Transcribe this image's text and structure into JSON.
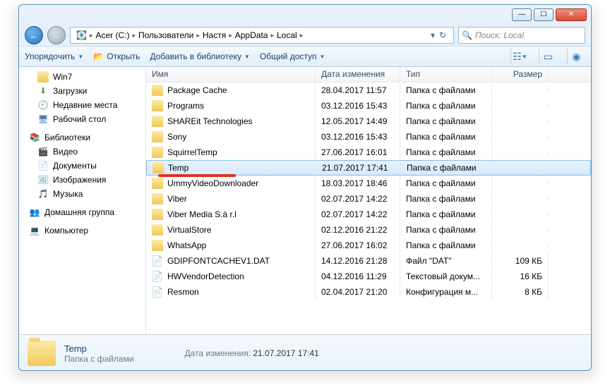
{
  "breadcrumb": [
    "Acer (C:)",
    "Пользователи",
    "Настя",
    "AppData",
    "Local"
  ],
  "search_placeholder": "Поиск: Local",
  "toolbar": {
    "organize": "Упорядочить",
    "open": "Открыть",
    "addlib": "Добавить в библиотеку",
    "share": "Общий доступ"
  },
  "columns": {
    "name": "Имя",
    "date": "Дата изменения",
    "type": "Тип",
    "size": "Размер"
  },
  "sidebar": [
    {
      "icon": "folder",
      "label": "Win7",
      "indent": 1
    },
    {
      "icon": "⬇",
      "label": "Загрузки",
      "indent": 1,
      "color": "#5a9f4a"
    },
    {
      "icon": "🕘",
      "label": "Недавние места",
      "indent": 1,
      "color": "#7a6ab0"
    },
    {
      "icon": "🖥",
      "label": "Рабочий стол",
      "indent": 1,
      "color": "#4a7ab0"
    },
    {
      "icon": "📚",
      "label": "Библиотеки",
      "indent": 0,
      "color": "#4a90c0"
    },
    {
      "icon": "🎬",
      "label": "Видео",
      "indent": 1,
      "color": "#3a6ab0"
    },
    {
      "icon": "📄",
      "label": "Документы",
      "indent": 1,
      "color": "#7a6a4a"
    },
    {
      "icon": "🖼",
      "label": "Изображения",
      "indent": 1,
      "color": "#4a9aa0"
    },
    {
      "icon": "🎵",
      "label": "Музыка",
      "indent": 1,
      "color": "#4a8ac0"
    },
    {
      "icon": "👥",
      "label": "Домашняя группа",
      "indent": 0,
      "color": "#6a9a5a"
    },
    {
      "icon": "💻",
      "label": "Компьютер",
      "indent": 0,
      "color": "#5a7a9a"
    }
  ],
  "files": [
    {
      "icon": "folder",
      "name": "Package Cache",
      "date": "28.04.2017 11:57",
      "type": "Папка с файлами",
      "size": ""
    },
    {
      "icon": "folder",
      "name": "Programs",
      "date": "03.12.2016 15:43",
      "type": "Папка с файлами",
      "size": ""
    },
    {
      "icon": "folder",
      "name": "SHAREit Technologies",
      "date": "12.05.2017 14:49",
      "type": "Папка с файлами",
      "size": ""
    },
    {
      "icon": "folder",
      "name": "Sony",
      "date": "03.12.2016 15:43",
      "type": "Папка с файлами",
      "size": ""
    },
    {
      "icon": "folder",
      "name": "SquirrelTemp",
      "date": "27.06.2017 16:01",
      "type": "Папка с файлами",
      "size": ""
    },
    {
      "icon": "folder",
      "name": "Temp",
      "date": "21.07.2017 17:41",
      "type": "Папка с файлами",
      "size": "",
      "selected": true,
      "redline": true
    },
    {
      "icon": "folder",
      "name": "UmmyVideoDownloader",
      "date": "18.03.2017 18:46",
      "type": "Папка с файлами",
      "size": ""
    },
    {
      "icon": "folder",
      "name": "Viber",
      "date": "02.07.2017 14:22",
      "type": "Папка с файлами",
      "size": ""
    },
    {
      "icon": "folder",
      "name": "Viber Media S.à r.l",
      "date": "02.07.2017 14:22",
      "type": "Папка с файлами",
      "size": ""
    },
    {
      "icon": "folder",
      "name": "VirtualStore",
      "date": "02.12.2016 21:22",
      "type": "Папка с файлами",
      "size": ""
    },
    {
      "icon": "folder",
      "name": "WhatsApp",
      "date": "27.06.2017 16:02",
      "type": "Папка с файлами",
      "size": ""
    },
    {
      "icon": "file",
      "name": "GDIPFONTCACHEV1.DAT",
      "date": "14.12.2016 21:28",
      "type": "Файл \"DAT\"",
      "size": "109 КБ"
    },
    {
      "icon": "file",
      "name": "HWVendorDetection",
      "date": "04.12.2016 11:29",
      "type": "Текстовый докум...",
      "size": "16 КБ"
    },
    {
      "icon": "file",
      "name": "Resmon",
      "date": "02.04.2017 21:20",
      "type": "Конфигурация м...",
      "size": "8 КБ"
    }
  ],
  "details": {
    "name": "Temp",
    "type": "Папка с файлами",
    "meta_label": "Дата изменения:",
    "meta_value": "21.07.2017 17:41"
  }
}
